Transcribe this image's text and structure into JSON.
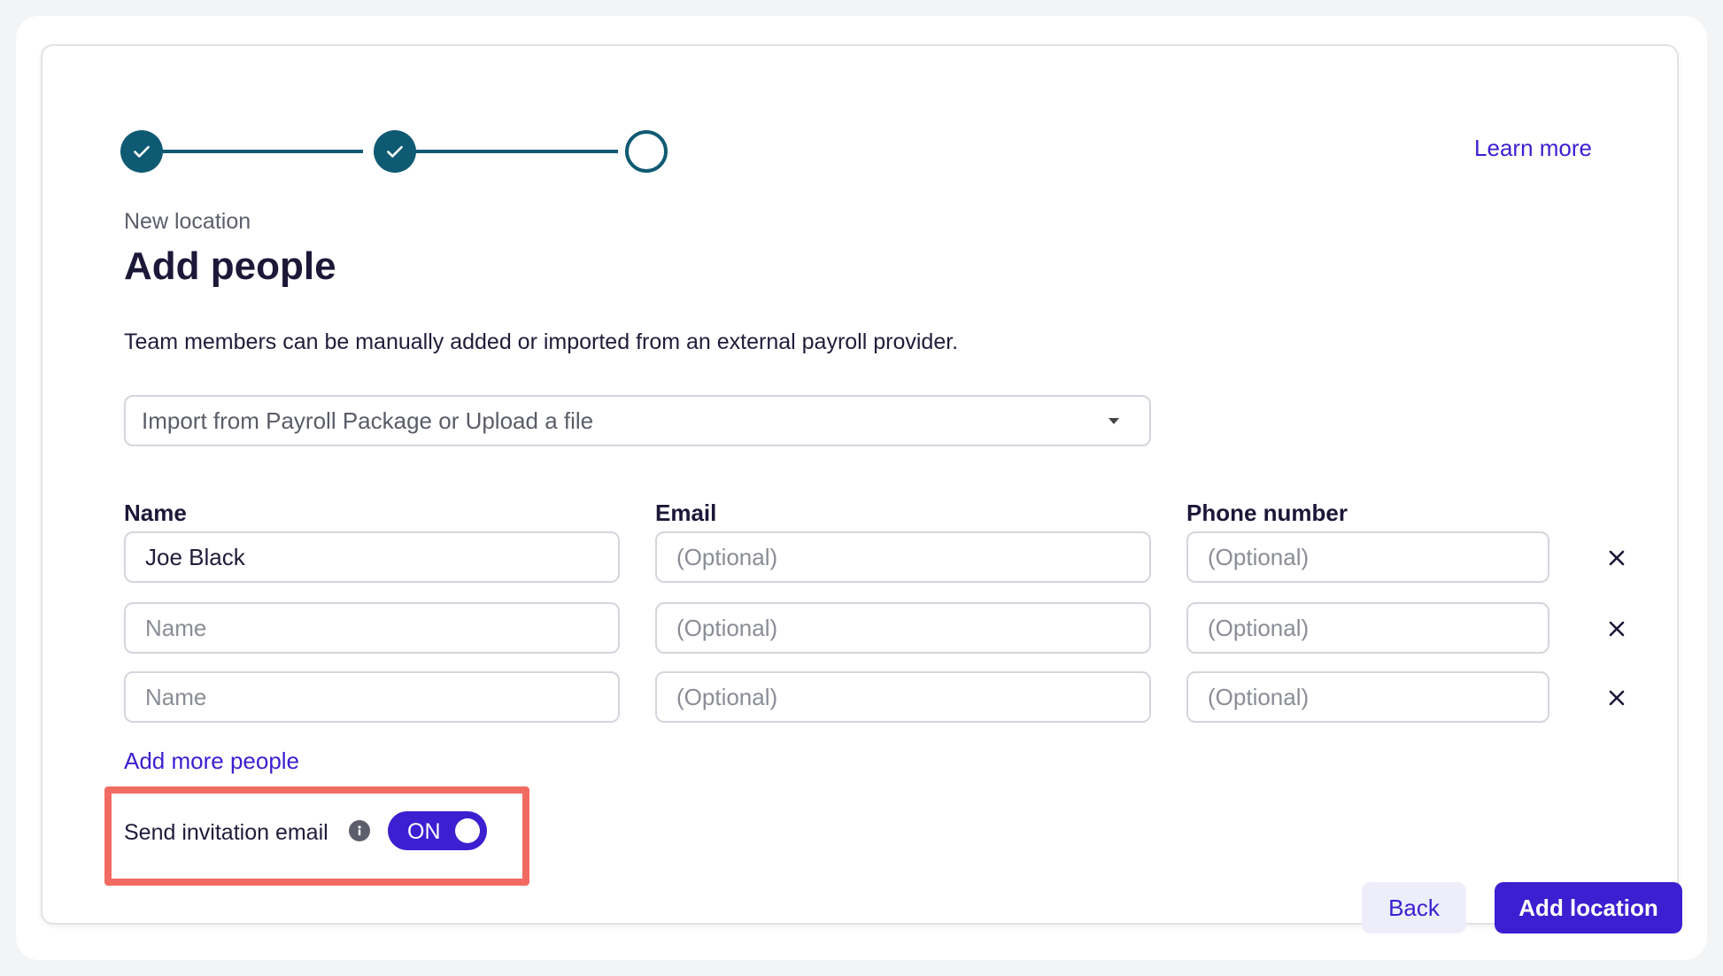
{
  "header": {
    "learn_more": "Learn more"
  },
  "stepper": {
    "steps": [
      "done",
      "done",
      "current"
    ]
  },
  "page": {
    "eyebrow": "New location",
    "title": "Add people",
    "description": "Team members can be manually added or imported from an external payroll provider."
  },
  "import_select": {
    "value": "Import from Payroll Package or Upload a file"
  },
  "table": {
    "columns": {
      "name": "Name",
      "email": "Email",
      "phone": "Phone number"
    },
    "rows": [
      {
        "name_value": "Joe Black",
        "name_placeholder": "Name",
        "email_placeholder": "(Optional)",
        "phone_placeholder": "(Optional)"
      },
      {
        "name_value": "",
        "name_placeholder": "Name",
        "email_placeholder": "(Optional)",
        "phone_placeholder": "(Optional)"
      },
      {
        "name_value": "",
        "name_placeholder": "Name",
        "email_placeholder": "(Optional)",
        "phone_placeholder": "(Optional)"
      }
    ]
  },
  "add_more": "Add more people",
  "invitation": {
    "label": "Send invitation email",
    "toggle_state": "ON"
  },
  "actions": {
    "back": "Back",
    "submit": "Add location"
  },
  "colors": {
    "accent": "#3b1fd1",
    "stepper": "#0f5a73",
    "highlight": "#f26b62"
  },
  "icons": {
    "step_check": "check-icon",
    "remove_row": "close-icon",
    "info": "info-icon",
    "dropdown": "caret-down-icon"
  }
}
